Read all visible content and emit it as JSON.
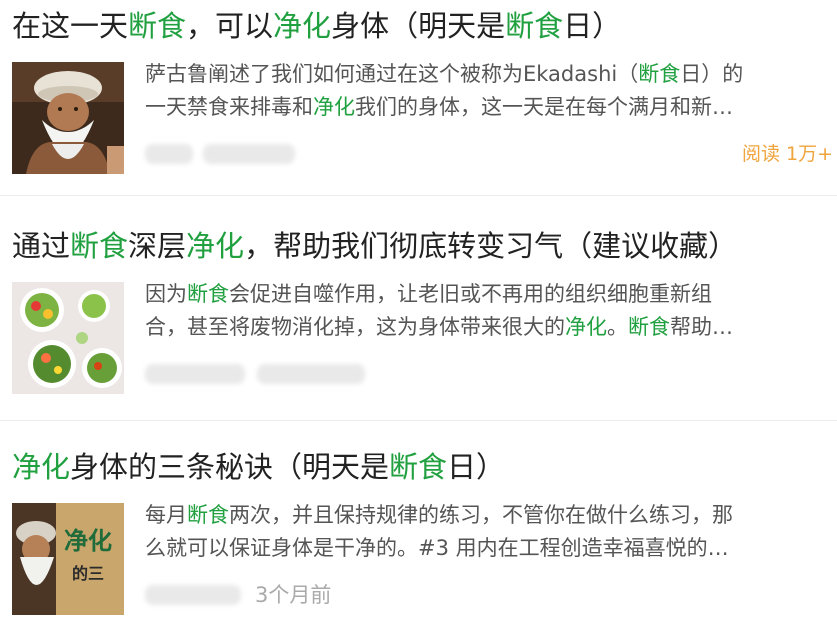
{
  "colors": {
    "highlight": "#21a040",
    "read_count": "#f0a43c",
    "summary_text": "#555555",
    "meta_text": "#aaaaaa"
  },
  "articles": [
    {
      "title_parts": [
        "在这一天",
        "断食",
        "，可以",
        "净化",
        "身体（明天是",
        "断食",
        "日）"
      ],
      "summary_line1": [
        "萨古鲁阐述了我们如何通过在这个被称为Ekadashi（",
        "断食",
        "日）的"
      ],
      "summary_line2": [
        "一天禁食来排毒和",
        "净化",
        "我们的身体，这一天是在每个满月和新…"
      ],
      "read_count": "阅读 1万+",
      "thumbnail": "portrait-bearded-man-turban"
    },
    {
      "title_parts": [
        "通过",
        "断食",
        "深层",
        "净化",
        "，帮助我们彻底转变习气（建议收藏）"
      ],
      "summary_line1": [
        "因为",
        "断食",
        "会促进自噬作用，让老旧或不再用的组织细胞重新组"
      ],
      "summary_line2": [
        "合，甚至将废物消化掉，这为身体带来很大的",
        "净化",
        "。",
        "断食",
        "帮助…"
      ],
      "thumbnail": "salad-bowls-on-table"
    },
    {
      "title_parts": [
        "净化",
        "身体的三条秘诀（明天是",
        "断食",
        "日）"
      ],
      "summary_line1": [
        "每月",
        "断食",
        "两次，并且保持规律的练习，不管你在做什么练习，那"
      ],
      "summary_line2": [
        "么就可以保证身体是干净的。#3 用内在工程创造幸福喜悦的…"
      ],
      "time": "3个月前",
      "thumbnail_text": "净化",
      "thumbnail_subtext": "的三",
      "thumbnail": "poster-with-bearded-man"
    }
  ]
}
